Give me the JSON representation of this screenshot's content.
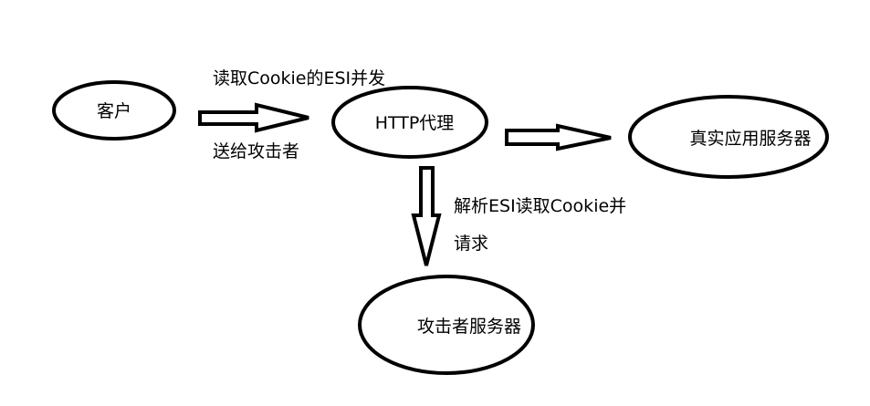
{
  "nodes": {
    "client": {
      "label": "客户"
    },
    "proxy": {
      "label": "HTTP代理"
    },
    "real_server": {
      "label": "真实应用服务器"
    },
    "attacker_server": {
      "label": "攻击者服务器"
    }
  },
  "edges": {
    "client_to_proxy": {
      "label_top": "读取Cookie的ESI并发",
      "label_bottom": "送给攻击者"
    },
    "proxy_to_real": {},
    "proxy_to_attacker": {
      "label_line1": "解析ESI读取Cookie并",
      "label_line2": "请求"
    }
  },
  "colors": {
    "stroke": "#000000",
    "background": "#ffffff"
  }
}
